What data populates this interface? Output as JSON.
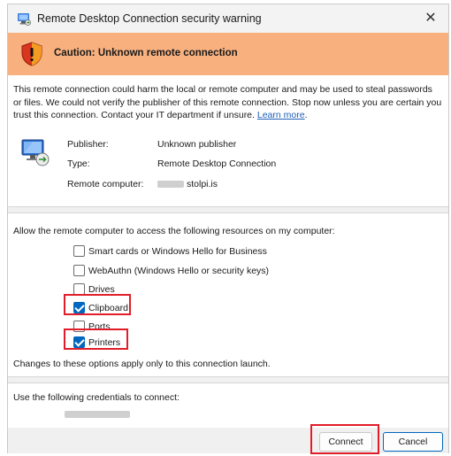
{
  "window": {
    "title": "Remote Desktop Connection security warning",
    "close_glyph": "✕"
  },
  "banner": {
    "caution": "Caution: Unknown remote connection",
    "color": "#f8b07f"
  },
  "warning": {
    "text": "This remote connection could harm the local or remote computer and may be used to steal passwords or files. We could not verify the publisher of this remote connection. Stop now unless you are certain you trust this connection. Contact your IT department if unsure.",
    "link": "Learn more"
  },
  "info": {
    "publisher_label": "Publisher:",
    "publisher_value": "Unknown publisher",
    "type_label": "Type:",
    "type_value": "Remote Desktop Connection",
    "remote_label": "Remote computer:",
    "remote_value": "stolpi.is"
  },
  "resources": {
    "intro": "Allow the remote computer to access the following resources on my computer:",
    "items": [
      {
        "label": "Smart cards or Windows Hello for Business",
        "checked": false
      },
      {
        "label": "WebAuthn (Windows Hello or security keys)",
        "checked": false
      },
      {
        "label": "Drives",
        "checked": false
      },
      {
        "label": "Clipboard",
        "checked": true
      },
      {
        "label": "Ports",
        "checked": false
      },
      {
        "label": "Printers",
        "checked": true
      }
    ],
    "note": "Changes to these options apply only to this connection launch."
  },
  "credentials": {
    "label": "Use the following credentials to connect:"
  },
  "buttons": {
    "connect": "Connect",
    "cancel": "Cancel"
  },
  "colors": {
    "accent": "#0067c0",
    "highlight": "#e11d2a",
    "link": "#1d5fb8"
  }
}
